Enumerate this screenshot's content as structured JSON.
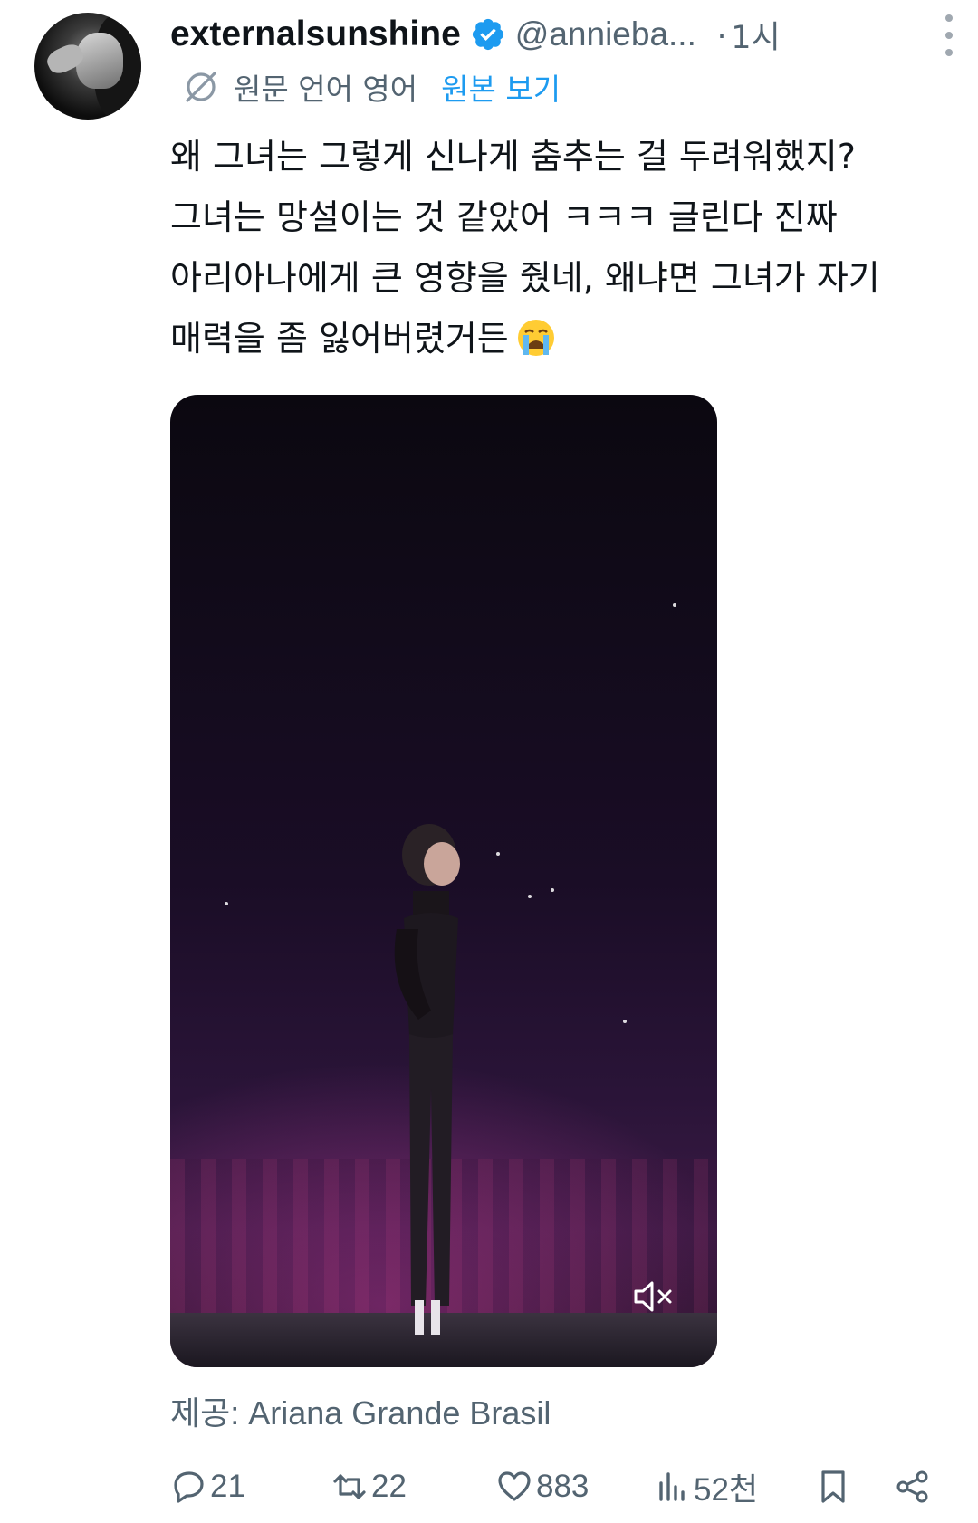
{
  "tweet": {
    "display_name": "externalsunshine",
    "verified": true,
    "handle": "@annieba...",
    "separator": "·",
    "time": "1시",
    "translation_label": "원문 언어 영어",
    "show_original": "원본 보기",
    "text_lines": [
      "왜 그녀는 그렇게 신나게 춤추는 걸 두려워했지?",
      "그녀는 망설이는 것 같았어 ㅋㅋㅋ 글린다 진짜",
      "아리아나에게 큰 영향을 줬네, 왜냐면 그녀가 자기",
      "매력을 좀 잃어버렸거든"
    ],
    "emoji": "loudly-crying-face",
    "media_credit": "제공: Ariana Grande Brasil"
  },
  "actions": {
    "replies": "21",
    "reposts": "22",
    "likes": "883",
    "views": "52천"
  },
  "colors": {
    "text": "#0f1419",
    "secondary": "#536471",
    "accent": "#1d9bf0",
    "verified_badge": "#1d9bf0"
  },
  "icons": [
    "more-icon",
    "verified-badge-icon",
    "translate-icon",
    "mute-icon",
    "reply-icon",
    "repost-icon",
    "like-icon",
    "views-icon",
    "bookmark-icon",
    "share-icon"
  ]
}
